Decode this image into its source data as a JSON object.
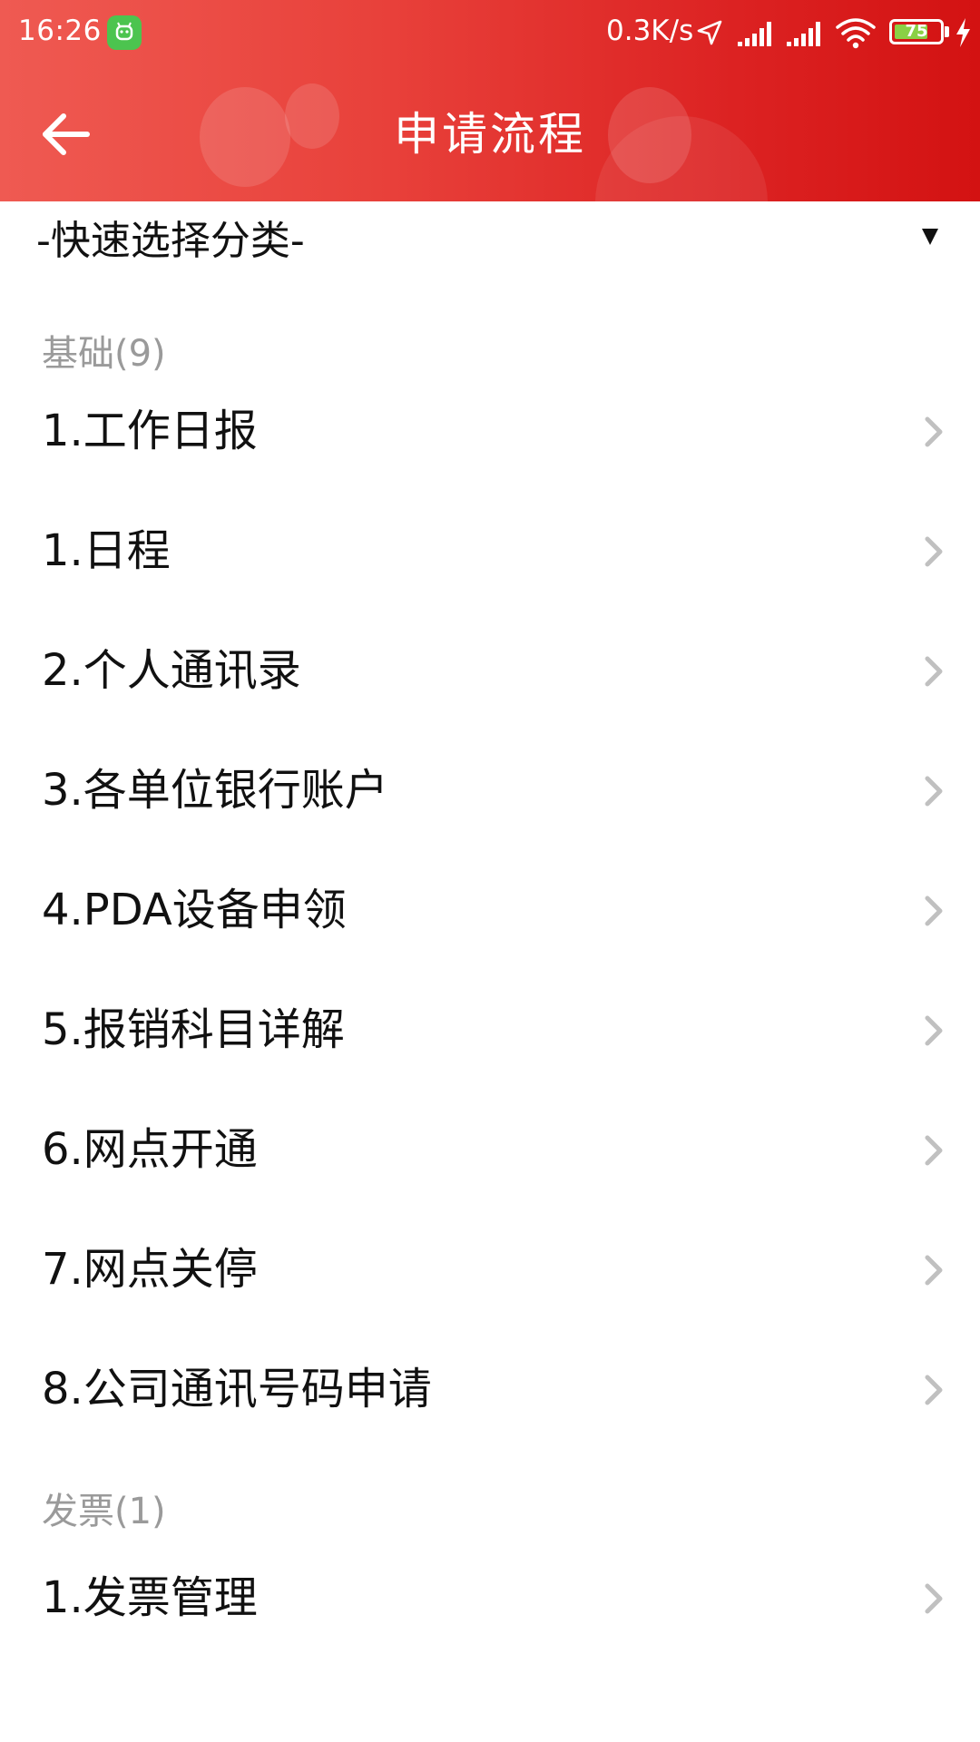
{
  "status_bar": {
    "time": "16:26",
    "net_speed": "0.3K/s",
    "battery_level": "75",
    "battery_fraction": 0.75
  },
  "header": {
    "title": "申请流程",
    "back_icon": "arrow-left-icon"
  },
  "category_select": {
    "selected": "-快速选择分类-"
  },
  "sections": [
    {
      "header": "基础(9)",
      "items": [
        "1.工作日报",
        "1.日程",
        "2.个人通讯录",
        "3.各单位银行账户",
        "4.PDA设备申领",
        "5.报销科目详解",
        "6.网点开通",
        "7.网点关停",
        "8.公司通讯号码申请"
      ]
    },
    {
      "header": "发票(1)",
      "items": [
        "1.发票管理"
      ]
    }
  ],
  "colors": {
    "header_start": "#ef5a52",
    "header_end": "#d31212",
    "section_text": "#9a9a9a",
    "item_text": "#111111",
    "chevron": "#c0c0c0"
  }
}
